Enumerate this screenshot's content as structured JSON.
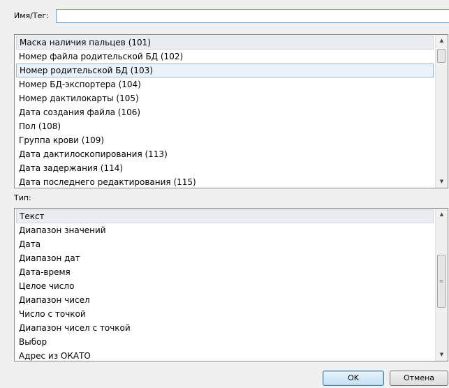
{
  "name_field": {
    "label": "Имя/Тег:",
    "value": ""
  },
  "tag_list": {
    "items": [
      "Маска наличия пальцев (101)",
      "Номер файла родительской БД (102)",
      "Номер родительской БД (103)",
      "Номер БД-экспортера (104)",
      "Номер дактилокарты (105)",
      "Дата создания файла (106)",
      "Пол (108)",
      "Группа крови (109)",
      "Дата дактилоскопирования (113)",
      "Дата задержания (114)",
      "Дата последнего редактирования (115)"
    ],
    "selected_index": 2
  },
  "type_field": {
    "label": "Тип:"
  },
  "type_list": {
    "items": [
      "Текст",
      "Диапазон значений",
      "Дата",
      "Диапазон дат",
      "Дата-время",
      "Целое число",
      "Диапазон чисел",
      "Число с точкой",
      "Диапазон чисел с точкой",
      "Выбор",
      "Адрес из ОКАТО"
    ]
  },
  "buttons": {
    "ok": "OK",
    "cancel": "Отмена"
  }
}
